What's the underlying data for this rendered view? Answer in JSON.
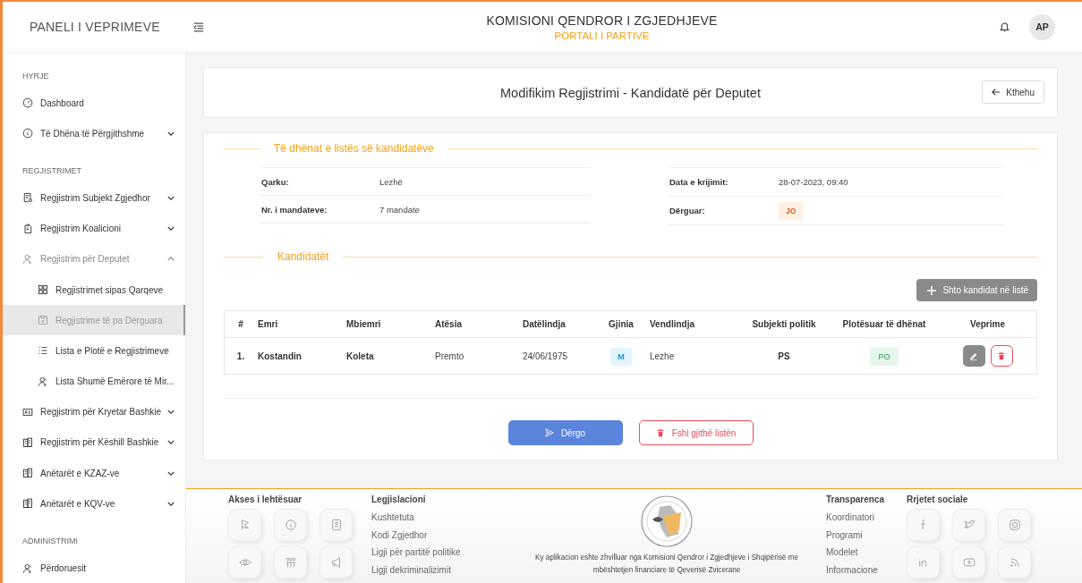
{
  "header": {
    "brand": "PANELI I VEPRIMEVE",
    "title": "KOMISIONI QENDROR I ZGJEDHJEVE",
    "subtitle": "PORTALI I PARTIVE",
    "avatar": "AP"
  },
  "sidebar": {
    "sections": [
      {
        "title": "HYRJE",
        "items": [
          {
            "label": "Dashboard",
            "selected": false
          },
          {
            "label": "Të Dhëna të Përgjithshme",
            "selected": false,
            "expanded": false
          }
        ]
      },
      {
        "title": "REGJISTRIMET",
        "items": [
          {
            "label": "Regjistrim Subjekt Zgjedhor",
            "selected": false,
            "expanded": false
          },
          {
            "label": "Regjistrim Koalicioni",
            "selected": false,
            "expanded": false
          },
          {
            "label": "Regjistrim për Deputet",
            "selected": false,
            "expanded": true,
            "children": [
              {
                "label": "Regjistrimet sipas Qarqeve",
                "selected": false
              },
              {
                "label": "Regjistrime të pa Dërguara",
                "selected": true
              },
              {
                "label": "Lista e Plotë e Regjistrimeve",
                "selected": false
              },
              {
                "label": "Lista Shumë Emërore të Mir...",
                "selected": false
              }
            ]
          },
          {
            "label": "Regjistrim për Kryetar Bashkie",
            "selected": false,
            "expanded": false
          },
          {
            "label": "Regjistrim për Këshill Bashkie",
            "selected": false,
            "expanded": false
          },
          {
            "label": "Anëtarët e KZAZ-ve",
            "selected": false,
            "expanded": false
          },
          {
            "label": "Anëtarët e KQV-ve",
            "selected": false,
            "expanded": false
          }
        ]
      },
      {
        "title": "ADMINISTRIMI",
        "items": [
          {
            "label": "Përdoruesit",
            "selected": false
          }
        ]
      }
    ]
  },
  "page": {
    "title": "Modifikim Regjistrimi - Kandidatë për Deputet",
    "back_button": "Kthehu"
  },
  "info": {
    "legend": "Të dhënat e listës së kandidatëve",
    "left": [
      {
        "label": "Qarku:",
        "value": "Lezhë",
        "kind": "text"
      },
      {
        "label": "Nr. i mandateve:",
        "value": "7 mandate",
        "kind": "text"
      }
    ],
    "right": [
      {
        "label": "Data e krijimit:",
        "value": "28-07-2023, 09:40",
        "kind": "text"
      },
      {
        "label": "Dërguar:",
        "value": "JO",
        "kind": "badge"
      }
    ]
  },
  "candidates": {
    "legend": "Kandidatët",
    "add_button": "Shto kandidat në listë",
    "columns": [
      "#",
      "Emri",
      "Mbiemri",
      "Atësia",
      "Datëlindja",
      "Gjinia",
      "Vendlindja",
      "Subjekti politik",
      "Plotësuar të dhënat",
      "Veprime"
    ],
    "rows": [
      {
        "cells": [
          "1.",
          "Kostandin",
          "Koleta",
          "Premto",
          "24/06/1975",
          "M",
          "Lezhe",
          "PS",
          "PO"
        ]
      }
    ]
  },
  "actions": {
    "submit": "Dërgo",
    "delete_all": "Fshi gjithë listën"
  },
  "footer": {
    "accessibility_title": "Akses i lehtësuar",
    "legislation": {
      "title": "Legjislacioni",
      "links": [
        "Kushtetuta",
        "Kodi Zgjedhor",
        "Ligji për partitë politike",
        "Ligji dekriminalizimit"
      ]
    },
    "credit": "Ky aplikacion eshte zhvilluar nga Komisioni Qendror i Zgjedhjeve i Shqipërisë me mbështetjen financiare të Qeverisë Zvicerane",
    "transparency": {
      "title": "Transparenca",
      "links": [
        "Koordinatori",
        "Programi",
        "Modelet",
        "Informacione"
      ]
    },
    "social_title": "Rrjetet sociale"
  }
}
